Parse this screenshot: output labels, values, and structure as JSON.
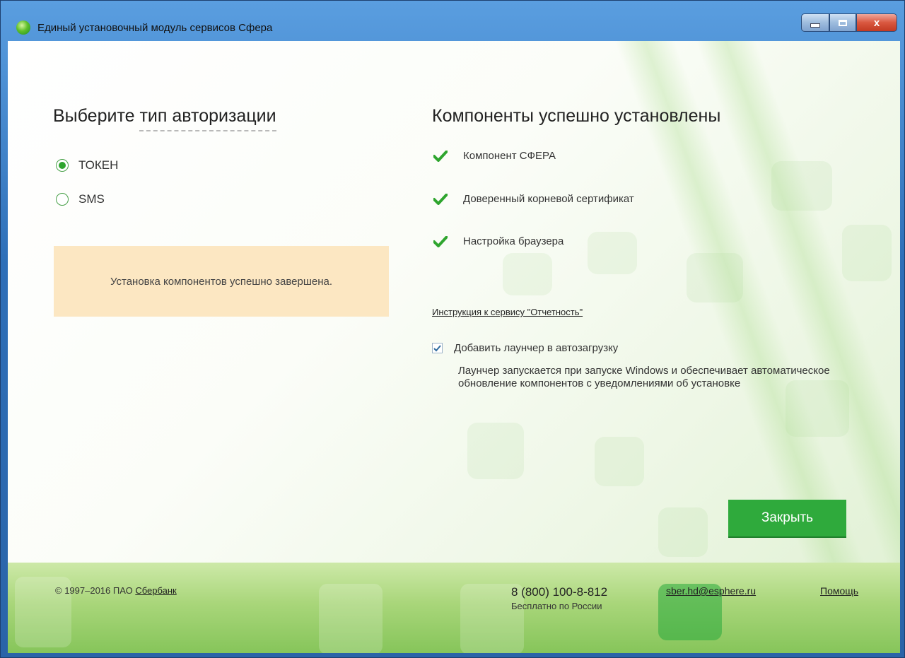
{
  "window": {
    "title": "Единый установочный модуль сервисов Сфера",
    "buttons": {
      "minimize": "minimize-icon",
      "maximize": "maximize-icon",
      "close": "x"
    }
  },
  "auth": {
    "heading_prefix": "Выберите ",
    "heading_dashed": "тип авторизации",
    "options": [
      {
        "label": "ТОКЕН",
        "selected": true
      },
      {
        "label": "SMS",
        "selected": false
      }
    ],
    "notice": "Установка компонентов успешно завершена."
  },
  "components": {
    "heading": "Компоненты успешно установлены",
    "items": [
      {
        "label": "Компонент СФЕРА",
        "icon": "check-icon"
      },
      {
        "label": "Доверенный корневой сертификат",
        "icon": "check-icon"
      },
      {
        "label": "Настройка браузера",
        "icon": "check-icon"
      }
    ],
    "instruction_link": "Инструкция к сервису \"Отчетность\"",
    "autostart": {
      "label": "Добавить лаунчер в автозагрузку",
      "checked": true,
      "description": "Лаунчер запускается при запуске Windows и обеспечивает автоматическое обновление компонентов с уведомлениями об установке"
    },
    "close_button": "Закрыть"
  },
  "footer": {
    "copyright": "© 1997–2016 ПАО ",
    "company_link": "Сбербанк",
    "phone": "8 (800) 100-8-812",
    "phone_note": "Бесплатно по России",
    "email": "sber.hd@esphere.ru",
    "help": "Помощь"
  },
  "colors": {
    "accent": "#2faa3c",
    "notice_bg": "#fce7c2",
    "check": "#2ea52e"
  }
}
